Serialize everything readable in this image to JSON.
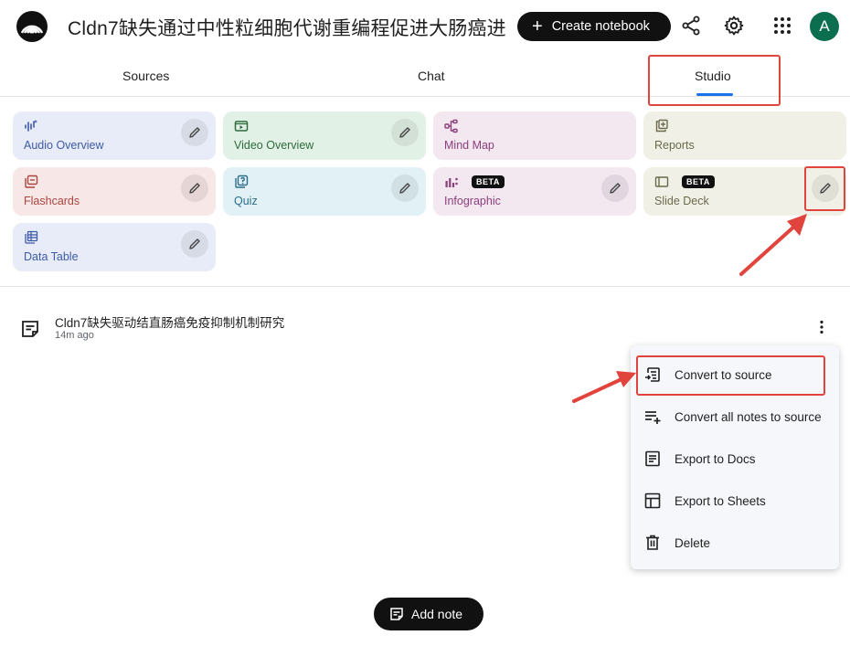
{
  "header": {
    "title": "Cldn7缺失通过中性粒细胞代谢重编程促进大肠癌进",
    "create_button": "Create notebook",
    "avatar_letter": "A"
  },
  "tabs": [
    {
      "label": "Sources"
    },
    {
      "label": "Chat"
    },
    {
      "label": "Studio",
      "active": true
    }
  ],
  "studio_cards": [
    {
      "label": "Audio Overview",
      "icon": "audio-waveform-icon"
    },
    {
      "label": "Video Overview",
      "icon": "video-icon"
    },
    {
      "label": "Mind Map",
      "icon": "mind-map-icon"
    },
    {
      "label": "Reports",
      "icon": "reports-icon"
    },
    {
      "label": "Flashcards",
      "icon": "flashcards-icon"
    },
    {
      "label": "Quiz",
      "icon": "quiz-icon"
    },
    {
      "label": "Infographic",
      "icon": "infographic-icon",
      "badge": "BETA"
    },
    {
      "label": "Slide Deck",
      "icon": "slide-deck-icon",
      "badge": "BETA"
    },
    {
      "label": "Data Table",
      "icon": "data-table-icon"
    }
  ],
  "note": {
    "title": "Cldn7缺失驱动结直肠癌免疫抑制机制研究",
    "time": "14m ago"
  },
  "menu": {
    "items": [
      {
        "label": "Convert to source",
        "icon": "convert-to-source-icon"
      },
      {
        "label": "Convert all notes to source",
        "icon": "playlist-add-icon"
      },
      {
        "label": "Export to Docs",
        "icon": "docs-icon"
      },
      {
        "label": "Export to Sheets",
        "icon": "sheets-icon"
      },
      {
        "label": "Delete",
        "icon": "trash-icon"
      }
    ]
  },
  "add_note_button": "Add note",
  "colors": {
    "accent": "#1a73e8",
    "annotation": "#e0443c",
    "avatar": "#0b6e4f"
  }
}
